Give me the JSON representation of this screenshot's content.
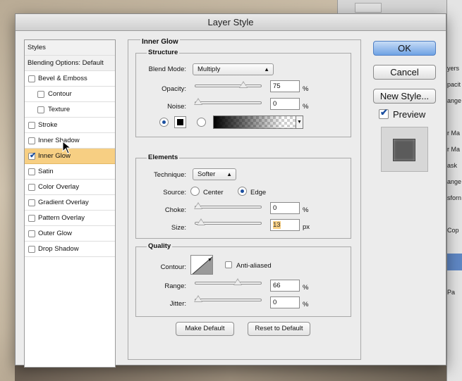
{
  "dialog": {
    "title": "Layer Style"
  },
  "styles_panel": {
    "header": "Styles",
    "blending": "Blending Options: Default",
    "items": [
      {
        "label": "Bevel & Emboss",
        "checked": false,
        "indent": 0
      },
      {
        "label": "Contour",
        "checked": false,
        "indent": 1
      },
      {
        "label": "Texture",
        "checked": false,
        "indent": 1
      },
      {
        "label": "Stroke",
        "checked": false,
        "indent": 0
      },
      {
        "label": "Inner Shadow",
        "checked": false,
        "indent": 0
      },
      {
        "label": "Inner Glow",
        "checked": true,
        "indent": 0,
        "selected": true
      },
      {
        "label": "Satin",
        "checked": false,
        "indent": 0
      },
      {
        "label": "Color Overlay",
        "checked": false,
        "indent": 0
      },
      {
        "label": "Gradient Overlay",
        "checked": false,
        "indent": 0
      },
      {
        "label": "Pattern Overlay",
        "checked": false,
        "indent": 0
      },
      {
        "label": "Outer Glow",
        "checked": false,
        "indent": 0
      },
      {
        "label": "Drop Shadow",
        "checked": false,
        "indent": 0
      }
    ]
  },
  "inner_glow": {
    "title": "Inner Glow",
    "structure": {
      "title": "Structure",
      "blend_mode_label": "Blend Mode:",
      "blend_mode": "Multiply",
      "opacity_label": "Opacity:",
      "opacity": "75",
      "opacity_fraction": 0.75,
      "noise_label": "Noise:",
      "noise": "0",
      "noise_fraction": 0.0,
      "unit": "%"
    },
    "elements": {
      "title": "Elements",
      "technique_label": "Technique:",
      "technique": "Softer",
      "source_label": "Source:",
      "source_center": "Center",
      "source_edge": "Edge",
      "source_selected": "Edge",
      "choke_label": "Choke:",
      "choke": "0",
      "choke_fraction": 0.0,
      "choke_unit": "%",
      "size_label": "Size:",
      "size": "13",
      "size_fraction": 0.05,
      "size_unit": "px"
    },
    "quality": {
      "title": "Quality",
      "contour_label": "Contour:",
      "anti_aliased_label": "Anti-aliased",
      "anti_aliased": false,
      "range_label": "Range:",
      "range": "66",
      "range_fraction": 0.66,
      "range_unit": "%",
      "jitter_label": "Jitter:",
      "jitter": "0",
      "jitter_fraction": 0.0,
      "jitter_unit": "%"
    },
    "make_default": "Make Default",
    "reset_default": "Reset to Default"
  },
  "buttons": {
    "ok": "OK",
    "cancel": "Cancel",
    "new_style": "New Style...",
    "preview_label": "Preview",
    "preview_checked": true
  },
  "background_panel": {
    "fragments": [
      "yers",
      "pacit",
      "ange",
      "r Ma",
      "r Ma",
      "ask",
      "ange",
      "sforn",
      "Cop",
      "Pa"
    ]
  },
  "colors": {
    "selection": "#f7cf83",
    "ok_button": "#6fa2e4",
    "glow_color": "#000000"
  }
}
